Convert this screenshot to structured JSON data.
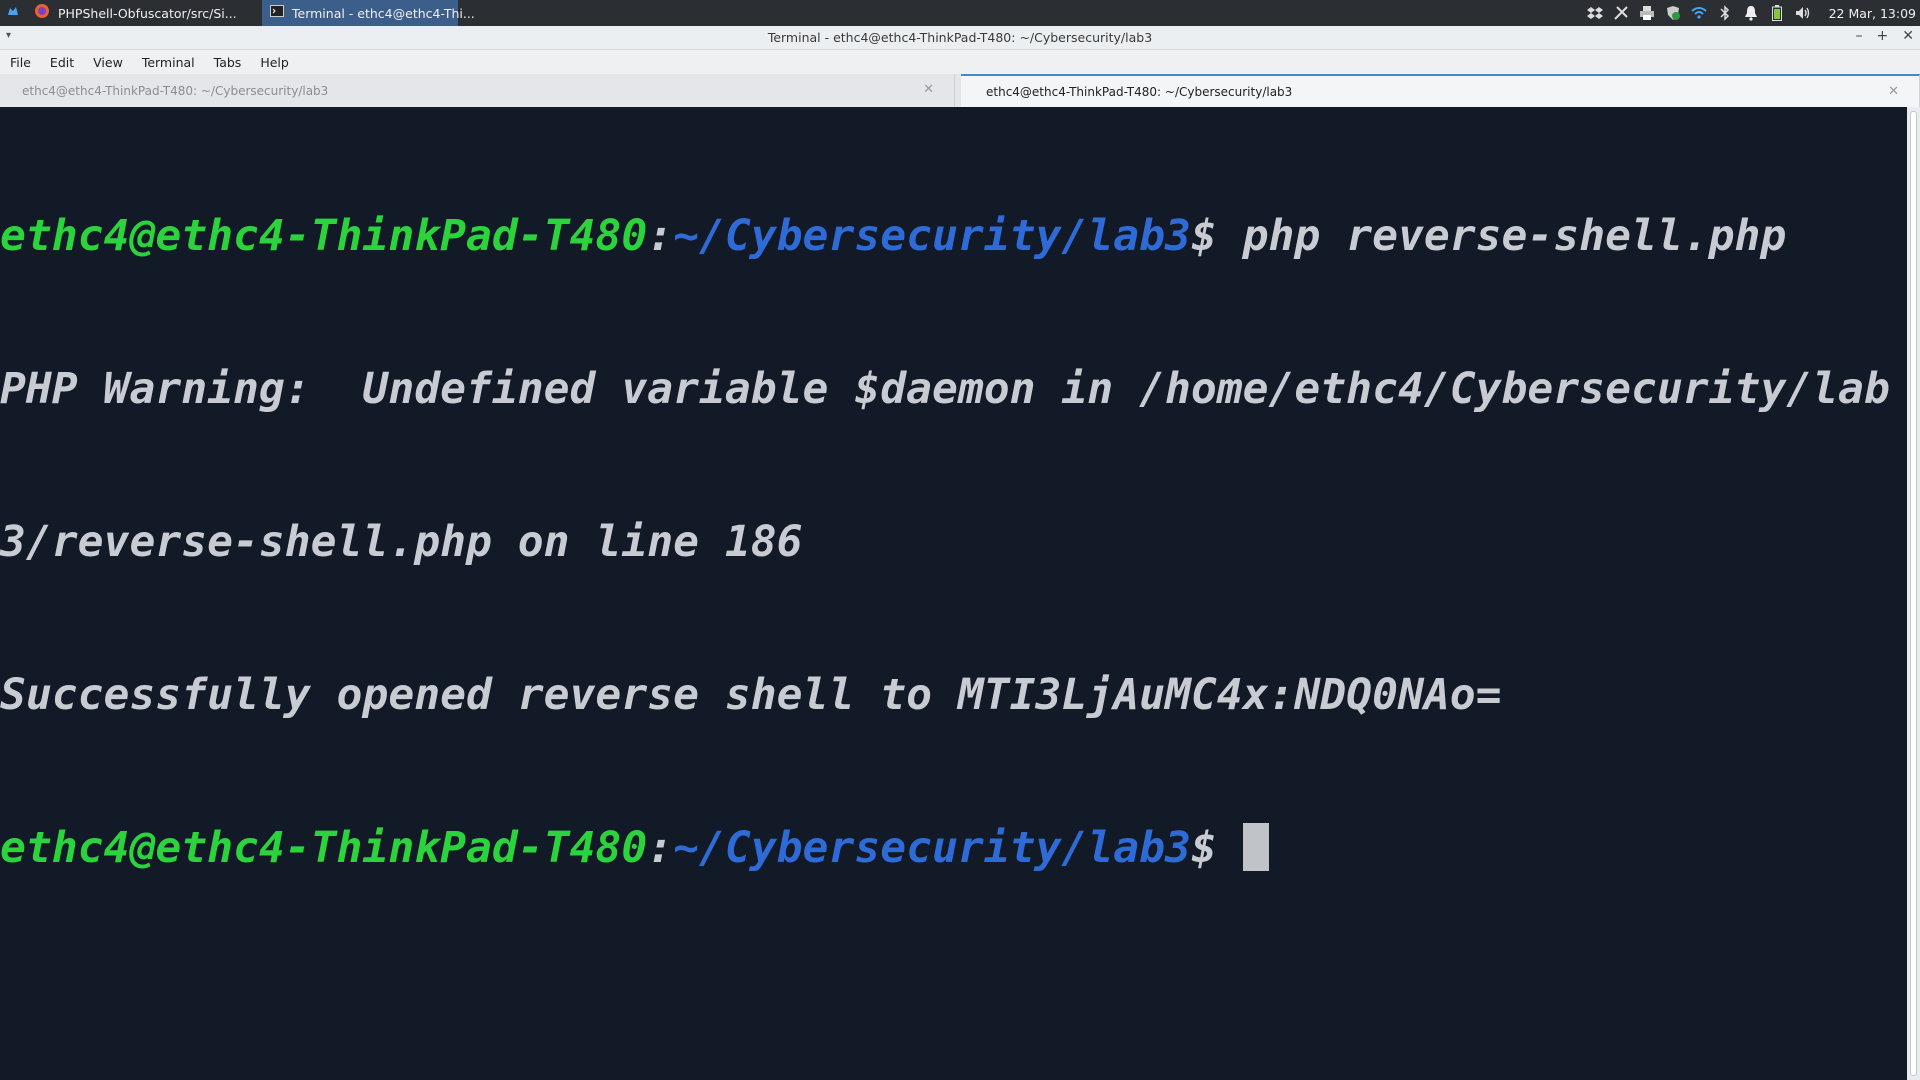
{
  "panel": {
    "tasks": [
      {
        "label": "PHPShell-Obfuscator/src/Si...",
        "icon": "firefox-icon"
      },
      {
        "label": "Terminal - ethc4@ethc4-Thi...",
        "icon": "terminal-icon"
      }
    ],
    "clock": "22 Mar, 13:09",
    "tray_icons": [
      "dropbox-icon",
      "network-tool-icon",
      "printer-icon",
      "shield-icon",
      "wifi-icon",
      "bluetooth-icon",
      "notification-bell-icon",
      "battery-icon",
      "volume-icon"
    ]
  },
  "window": {
    "title": "Terminal - ethc4@ethc4-ThinkPad-T480: ~/Cybersecurity/lab3"
  },
  "menubar": {
    "file": "File",
    "edit": "Edit",
    "view": "View",
    "terminal": "Terminal",
    "tabs": "Tabs",
    "help": "Help"
  },
  "tabs": [
    {
      "label": "ethc4@ethc4-ThinkPad-T480: ~/Cybersecurity/lab3",
      "active": false
    },
    {
      "label": "ethc4@ethc4-ThinkPad-T480: ~/Cybersecurity/lab3",
      "active": true
    }
  ],
  "terminal": {
    "prompt_user": "ethc4@ethc4-ThinkPad-T480",
    "prompt_colon": ":",
    "prompt_path": "~/Cybersecurity/lab3",
    "prompt_dollar": "$ ",
    "command": "php reverse-shell.php",
    "output_line1": "PHP Warning:  Undefined variable $daemon in /home/ethc4/Cybersecurity/lab",
    "output_line2": "3/reverse-shell.php on line 186",
    "output_line3": "Successfully opened reverse shell to MTI3LjAuMC4x:NDQ0NAo="
  },
  "colors": {
    "terminal_bg": "#131a27",
    "prompt_user": "#2bd43d",
    "prompt_path": "#2f6bd6",
    "text": "#c8ccd2",
    "active_task": "#3b5f8a"
  }
}
